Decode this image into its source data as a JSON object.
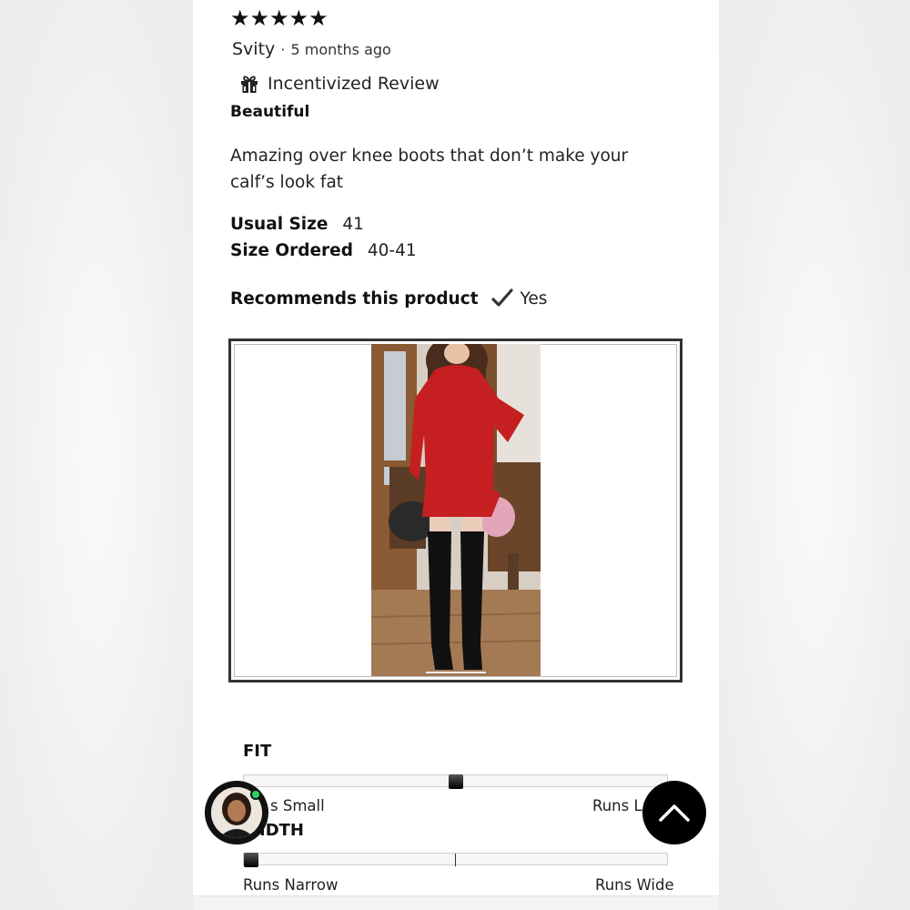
{
  "review": {
    "stars": "★★★★★",
    "rating": 5,
    "author": "Svity",
    "separator": "·",
    "time_ago": "5 months ago",
    "incentivized_label": "Incentivized Review",
    "headline": "Beautiful",
    "body": "Amazing over knee boots that don’t make your calf’s look fat",
    "usual_size_label": "Usual Size",
    "usual_size_value": "41",
    "size_ordered_label": "Size Ordered",
    "size_ordered_value": "40-41",
    "recommends_label": "Recommends this product",
    "recommends_value": "Yes"
  },
  "fit": {
    "title": "FIT",
    "left_label": "s Small",
    "right_label": "Runs La",
    "level": 0.5
  },
  "width": {
    "title": "IDTH",
    "left_label": "Runs Narrow",
    "right_label": "Runs Wide",
    "level": 0.0
  },
  "icons": {
    "gift": "gift-icon",
    "check": "check-icon",
    "scroll_top": "chevron-up-icon"
  },
  "colors": {
    "dress": "#c51f22",
    "online_dot": "#2bd15c",
    "fab": "#000000"
  }
}
